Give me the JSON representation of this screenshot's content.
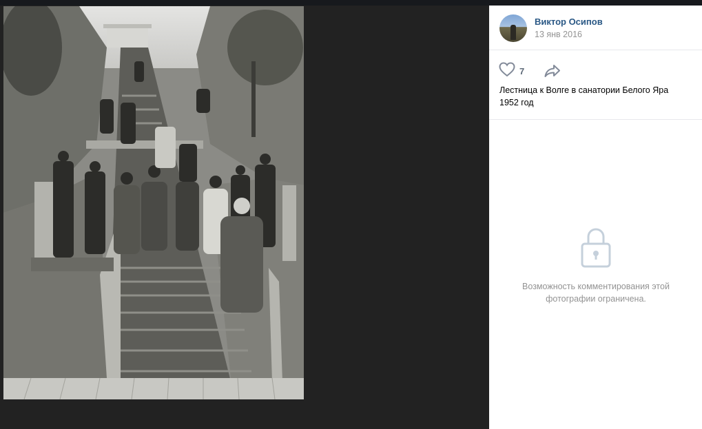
{
  "post": {
    "author_name": "Виктор Осипов",
    "date": "13 янв 2016",
    "likes": "7",
    "caption_line1": "Лестница к Волге в санатории Белого Яра",
    "caption_line2": "1952 год"
  },
  "comments": {
    "closed_line1": "Возможность комментирования этой",
    "closed_line2": "фотографии ограничена."
  },
  "icons": {
    "like": "heart-outline-icon",
    "share": "share-arrow-icon",
    "lock": "lock-icon"
  },
  "colors": {
    "link": "#2a5885",
    "muted": "#939393",
    "viewer_bg": "#222222",
    "panel_bg": "#ffffff"
  }
}
